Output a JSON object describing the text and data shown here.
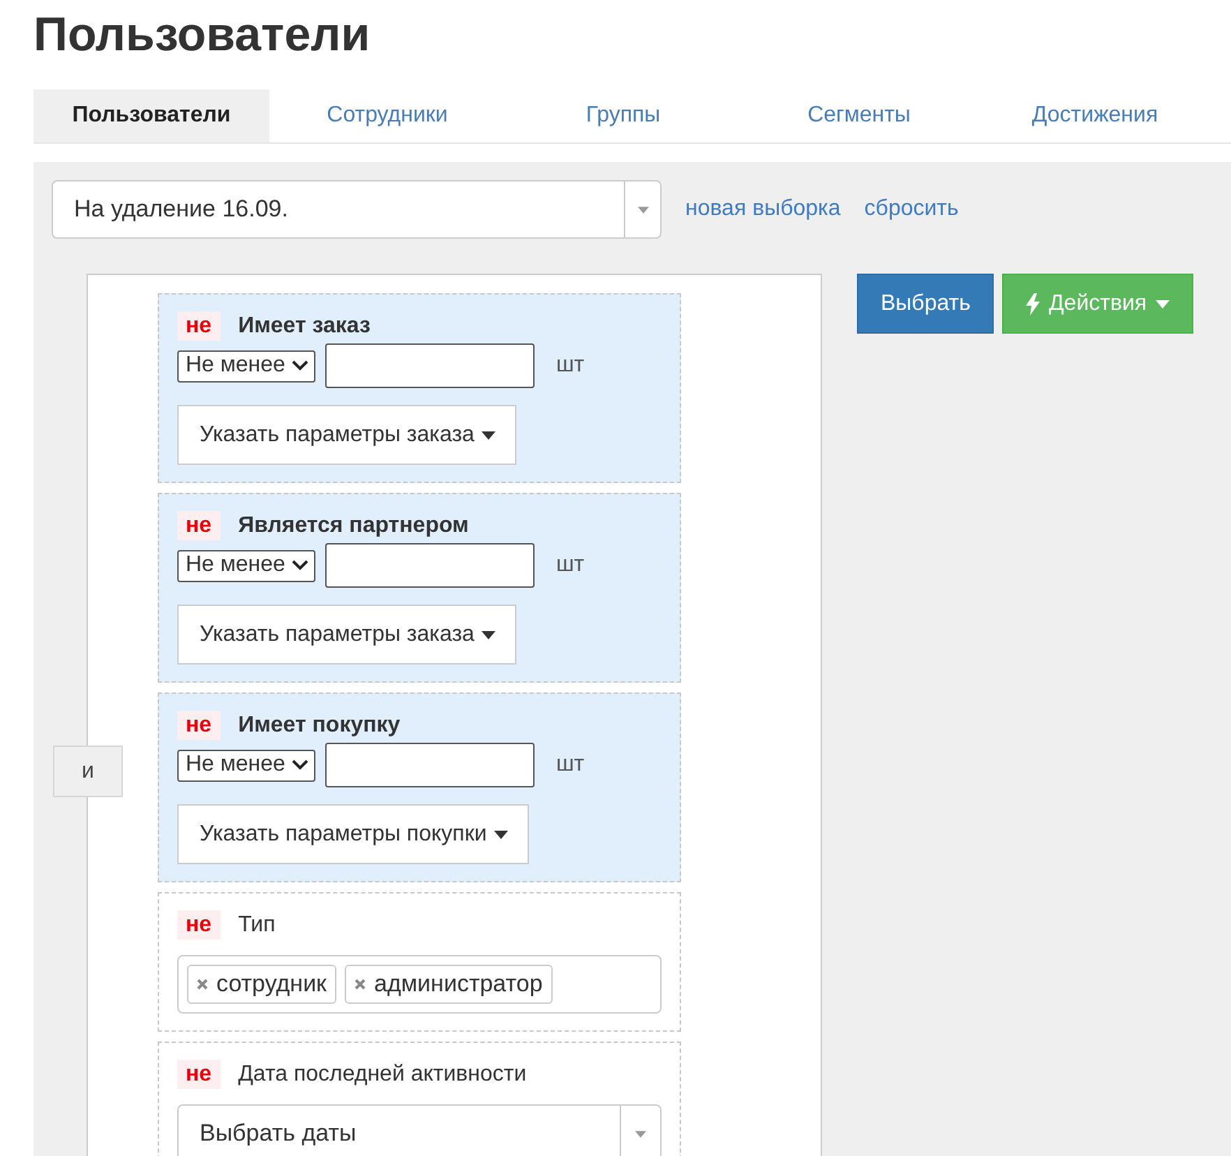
{
  "title": "Пользователи",
  "tabs": [
    {
      "label": "Пользователи",
      "selected": true
    },
    {
      "label": "Сотрудники",
      "selected": false
    },
    {
      "label": "Группы",
      "selected": false
    },
    {
      "label": "Сегменты",
      "selected": false
    },
    {
      "label": "Достижения",
      "selected": false
    }
  ],
  "filter": {
    "saved_selection": "На удаление 16.09.",
    "links": [
      "новая выборка",
      "сбросить"
    ]
  },
  "connector": "и",
  "conditions": [
    {
      "kind": "quantity",
      "negate": "не",
      "title": "Имеет заказ",
      "operator": "Не менее",
      "unit": "шт",
      "params_button": "Указать параметры заказа"
    },
    {
      "kind": "quantity",
      "negate": "не",
      "title": "Является партнером",
      "operator": "Не менее",
      "unit": "шт",
      "params_button": "Указать параметры заказа"
    },
    {
      "kind": "quantity",
      "negate": "не",
      "title": "Имеет покупку",
      "operator": "Не менее",
      "unit": "шт",
      "params_button": "Указать параметры покупки"
    },
    {
      "kind": "tags",
      "negate": "не",
      "title": "Тип",
      "tags": [
        "сотрудник",
        "администратор"
      ]
    },
    {
      "kind": "daterange",
      "negate": "не",
      "title": "Дата последней активности",
      "placeholder": "Выбрать даты"
    }
  ],
  "buttons": {
    "select": "Выбрать",
    "actions": "Действия"
  }
}
